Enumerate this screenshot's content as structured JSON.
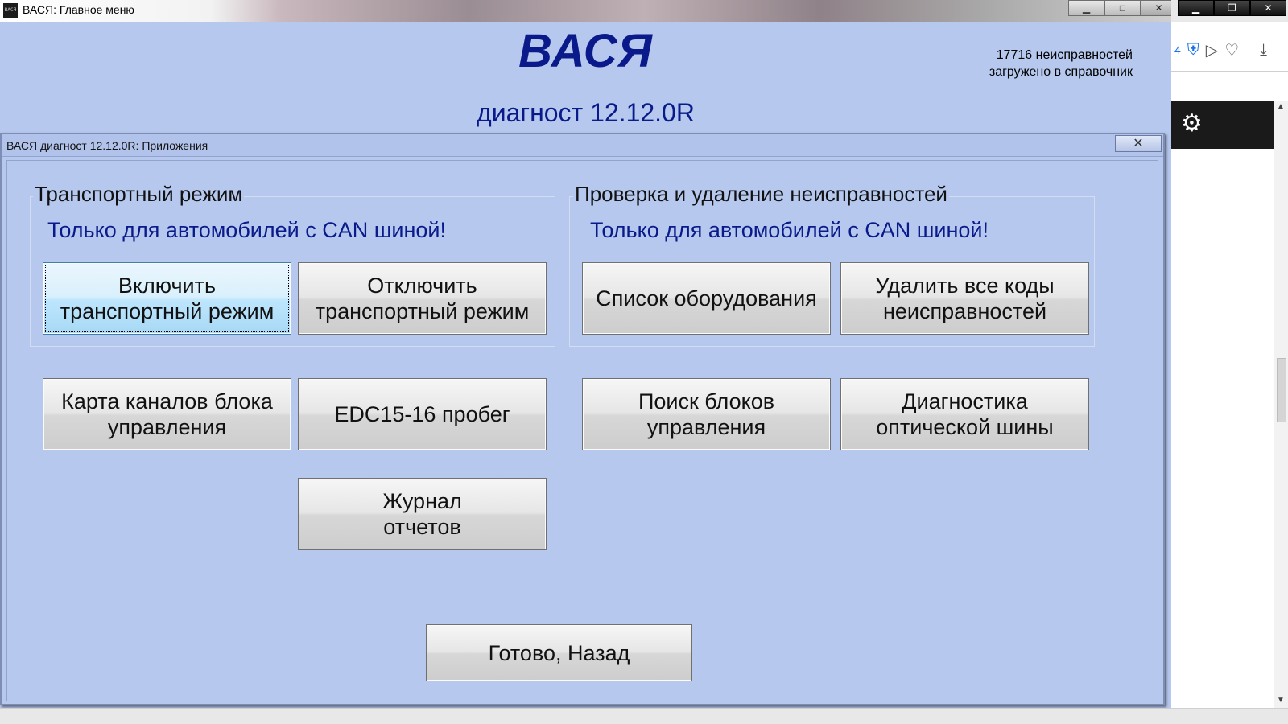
{
  "main_window": {
    "title": "ВАСЯ:  Главное меню",
    "app_icon_text": "ВАСЯ",
    "minimize": "▁",
    "maximize": "□",
    "close": "✕"
  },
  "header": {
    "app_name": "ВАСЯ",
    "version": "диагност 12.12.0R",
    "fault_count_line1": "17716 неисправностей",
    "fault_count_line2": "загружено в справочник"
  },
  "dialog": {
    "title": "ВАСЯ диагност 12.12.0R:  Приложения",
    "close": "✕",
    "transport_group": {
      "title": "Транспортный режим",
      "note": "Только для автомобилей с CAN шиной!"
    },
    "faults_group": {
      "title": "Проверка и удаление неисправностей",
      "note": "Только для автомобилей с CAN шиной!"
    },
    "buttons": {
      "enable_transport": "Включить\nтранспортный режим",
      "disable_transport": "Отключить\nтранспортный режим",
      "equipment_list": "Список оборудования",
      "delete_all_codes": "Удалить все коды\nнеисправностей",
      "channel_map": "Карта каналов блока\nуправления",
      "edc_mileage": "EDC15-16 пробег",
      "find_modules": "Поиск блоков\nуправления",
      "optical_bus": "Диагностика\nоптической шины",
      "reports_log": "Журнал\nотчетов",
      "done_back": "Готово, Назад"
    }
  },
  "browser": {
    "minimize": "▁",
    "restore": "❐",
    "close": "✕",
    "tab_number": "4",
    "icons": [
      "shield-icon",
      "send-icon",
      "heart-icon",
      "download-icon",
      "gear-icon"
    ],
    "shield_glyph": "⛨",
    "send_glyph": "▷",
    "heart_glyph": "♡",
    "download_glyph": "⤓",
    "gear_glyph": "⚙"
  },
  "colors": {
    "window_bg": "#b6c8ee",
    "title_blue": "#0a1a8a",
    "focused_button": "#bee6fd"
  }
}
